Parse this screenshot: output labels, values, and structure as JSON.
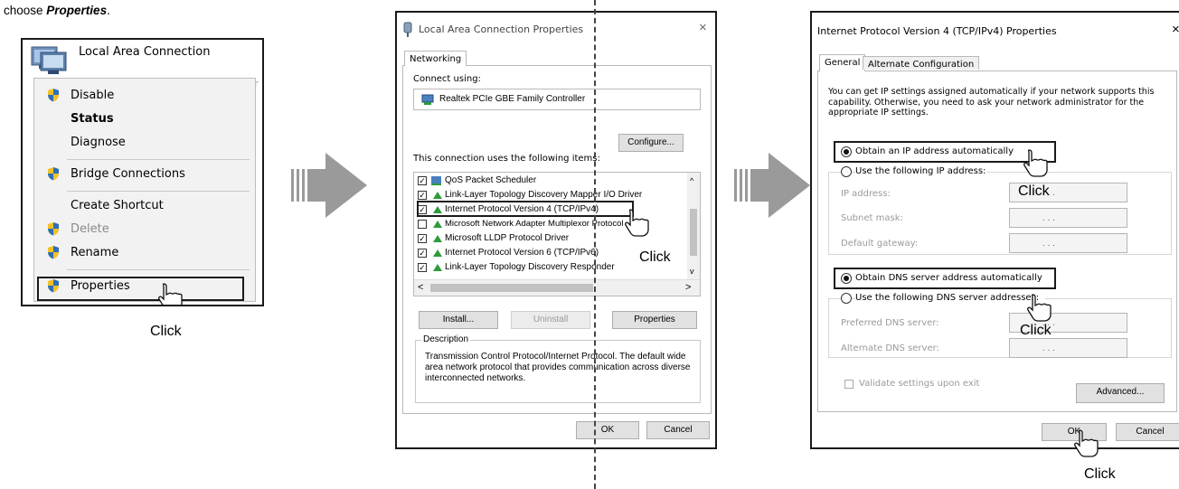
{
  "caption": {
    "prefix": "choose ",
    "emphasis": "Properties",
    "suffix": "."
  },
  "panel1": {
    "title": "Local Area Connection",
    "ghost_text": "er",
    "menu": {
      "disable": "Disable",
      "status": "Status",
      "diagnose": "Diagnose",
      "bridge": "Bridge Connections",
      "shortcut": "Create Shortcut",
      "delete": "Delete",
      "rename": "Rename",
      "properties": "Properties"
    },
    "click": "Click"
  },
  "dialog2": {
    "title": "Local Area Connection Properties",
    "tab": "Networking",
    "connect_using": "Connect using:",
    "adapter": "Realtek PCIe GBE Family Controller",
    "configure": "Configure...",
    "items_label": "This connection uses the following items:",
    "items": [
      {
        "label": "QoS Packet Scheduler",
        "checked": true
      },
      {
        "label": "Link-Layer Topology Discovery Mapper I/O Driver",
        "checked": true
      },
      {
        "label": "Internet Protocol Version 4 (TCP/IPv4)",
        "checked": true
      },
      {
        "label": "Microsoft Network Adapter Multiplexor Protocol",
        "checked": false
      },
      {
        "label": "Microsoft LLDP Protocol Driver",
        "checked": true
      },
      {
        "label": "Internet Protocol Version 6 (TCP/IPv6)",
        "checked": true
      },
      {
        "label": "Link-Layer Topology Discovery Responder",
        "checked": true
      }
    ],
    "install": "Install...",
    "uninstall": "Uninstall",
    "properties": "Properties",
    "description_title": "Description",
    "description": "Transmission Control Protocol/Internet Protocol. The default wide area network protocol that provides communication across diverse interconnected networks.",
    "ok": "OK",
    "cancel": "Cancel",
    "click": "Click"
  },
  "dialog3": {
    "title": "Internet Protocol Version 4 (TCP/IPv4) Properties",
    "close": "×",
    "tab_general": "General",
    "tab_alternate": "Alternate Configuration",
    "intro": "You can get IP settings assigned automatically if your network supports this capability. Otherwise, you need to ask your network administrator for the appropriate IP settings.",
    "obtain_ip": "Obtain an IP address automatically",
    "use_ip": "Use the following IP address:",
    "ip_label": "IP address:",
    "subnet_label": "Subnet mask:",
    "gateway_label": "Default gateway:",
    "obtain_dns": "Obtain DNS server address automatically",
    "use_dns": "Use the following DNS server addresses:",
    "pref_dns": "Preferred DNS server:",
    "alt_dns": "Alternate DNS server:",
    "validate": "Validate settings upon exit",
    "advanced": "Advanced...",
    "ok": "OK",
    "cancel": "Cancel",
    "click_ip": "Click",
    "click_dns": "Click",
    "click_ok": "Click",
    "ip_dots": ".    .    ."
  },
  "colors": {
    "shield_blue": "#2f6fb4",
    "shield_yellow": "#f2c029",
    "arrow_gray": "#9a9a9a",
    "net_green": "#2e9b3a"
  }
}
